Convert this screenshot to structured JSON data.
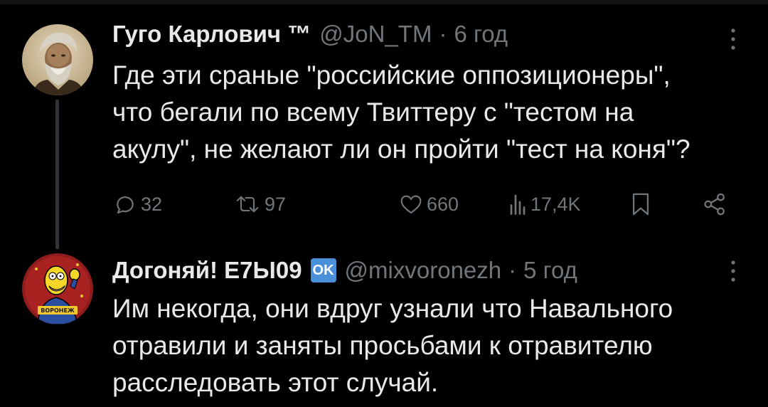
{
  "tweets": [
    {
      "author": "Гуго Карлович ™",
      "handle": "@JoN_TM",
      "separator": "·",
      "time": "6 год",
      "lines": [
        "Где эти сраные \"российские оппозиционеры\",",
        "что бегали по всему Твиттеру с \"тестом на",
        "акулу\", не желают ли он пройти \"тест на коня\"?"
      ],
      "actions": {
        "replies": "32",
        "retweets": "97",
        "likes": "660",
        "views": "17,4K"
      }
    },
    {
      "author": "Догоняй! Е7Ы09",
      "emoji_badge": "OK",
      "handle": "@mixvoronezh",
      "separator": "·",
      "time": "5 год",
      "lines": [
        "Им некогда, они вдруг узнали что Навального",
        "отравили и заняты просьбами к отравителю",
        "расследовать этот случай."
      ],
      "avatar_caption": "ВОРОНЕЖ"
    }
  ],
  "icons": {
    "reply": "reply-icon",
    "retweet": "retweet-icon",
    "like": "heart-icon",
    "views": "views-icon",
    "bookmark": "bookmark-icon",
    "share": "share-icon",
    "more": "more-vertical-icon"
  },
  "colors": {
    "background": "#000000",
    "text": "#e7e9ea",
    "secondary": "#71767b",
    "thread_line": "#333639",
    "ok_badge": "#4a90d9"
  }
}
